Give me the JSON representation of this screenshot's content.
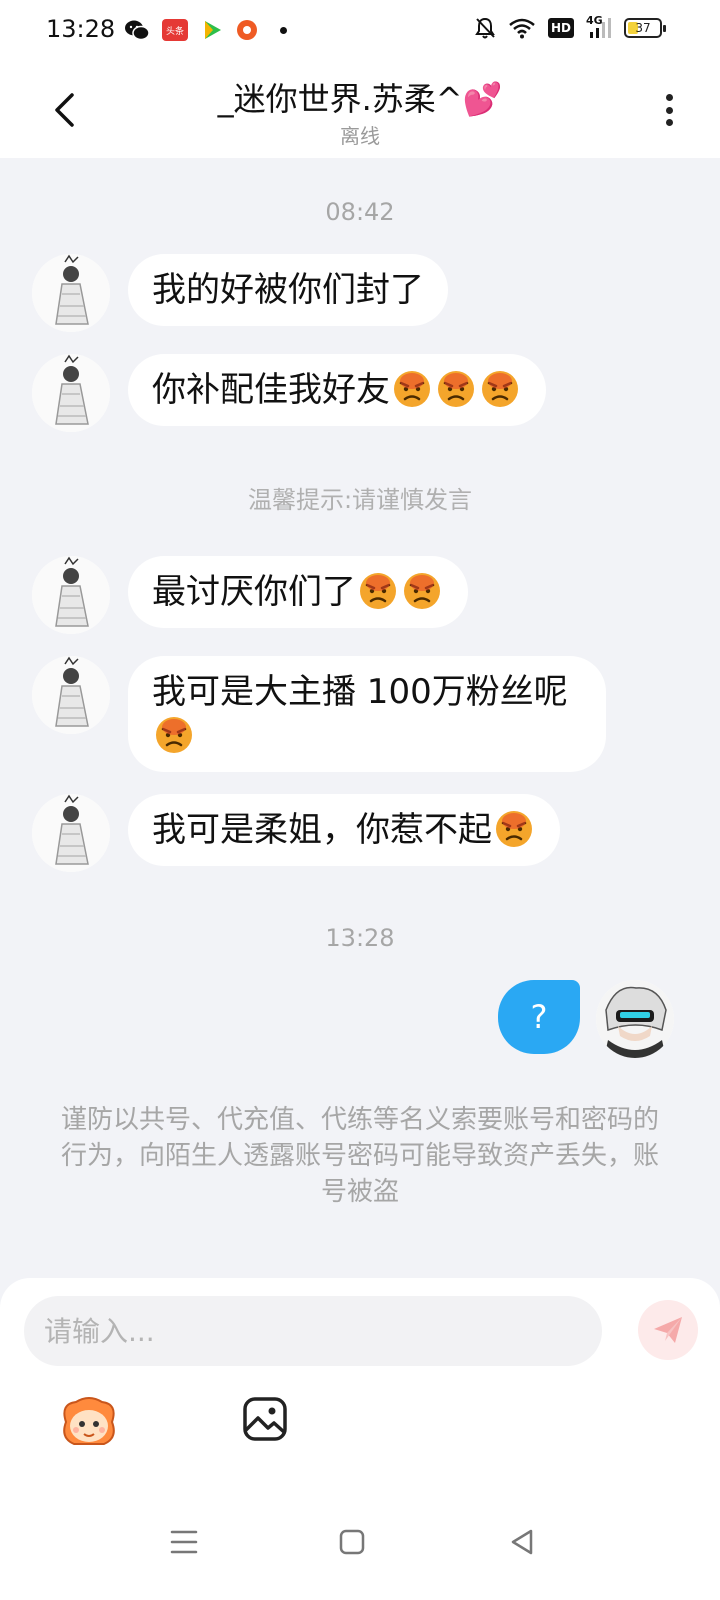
{
  "status_bar": {
    "time": "13:28",
    "net_label": "4G",
    "battery": "37",
    "hd": "HD",
    "news_app_label": "头条"
  },
  "header": {
    "title": "_迷你世界.苏柔^💕",
    "subtitle": "离线"
  },
  "chat": {
    "time_1": "08:42",
    "messages_a": [
      {
        "text": "我的好被你们封了",
        "emoji_count": 0
      },
      {
        "text": "你补配佳我好友",
        "emoji_count": 3
      }
    ],
    "system_tip": "温馨提示:请谨慎发言",
    "messages_b": [
      {
        "text": "最讨厌你们了",
        "emoji_count": 2
      },
      {
        "text": "我可是大主播 100万粉丝呢",
        "emoji_count": 1
      },
      {
        "text": "我可是柔姐，你惹不起",
        "emoji_count": 1
      }
    ],
    "time_2": "13:28",
    "my_message": "?",
    "warning": "谨防以共号、代充值、代练等名义索要账号和密码的行为，向陌生人透露账号密码可能导致资产丢失，账号被盗"
  },
  "input": {
    "placeholder": "请输入..."
  },
  "colors": {
    "my_bubble": "#2aa8f3",
    "background": "#f2f3f7",
    "send_button": "#fdeaea"
  },
  "icons": [
    "back-arrow-icon",
    "more-vertical-icon",
    "angry-emoji-icon",
    "send-icon",
    "emoji-panel-icon",
    "image-icon",
    "menu-icon",
    "home-square-icon",
    "back-triangle-icon"
  ]
}
